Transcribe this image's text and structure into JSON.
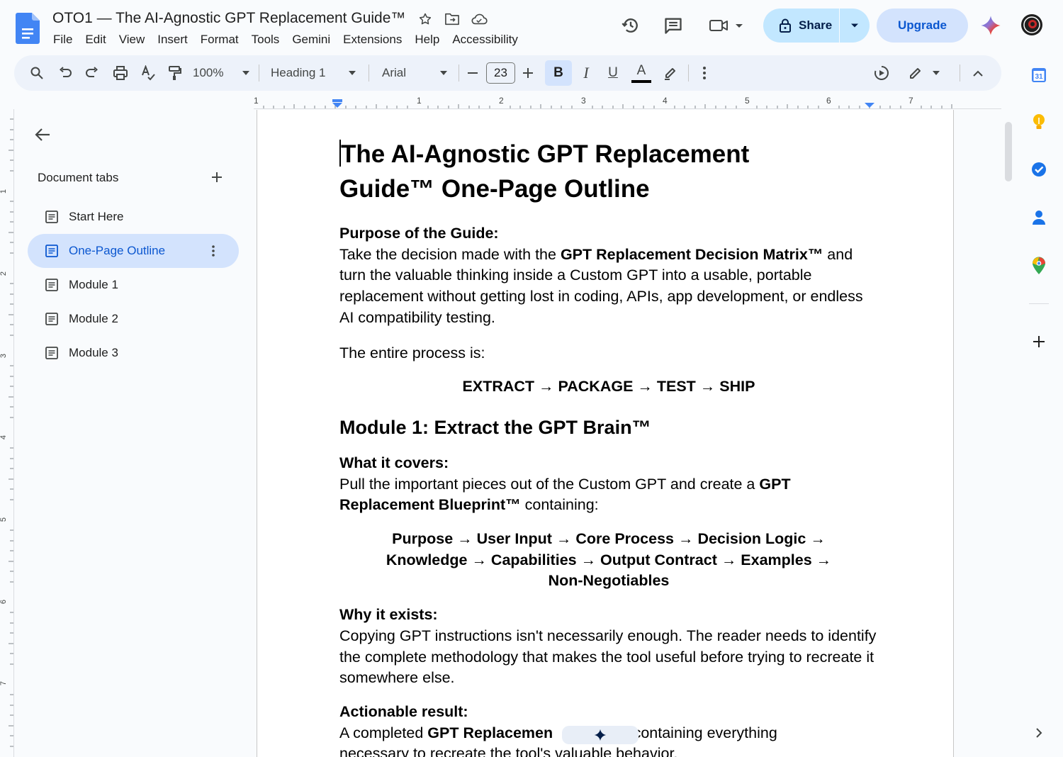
{
  "window": {
    "title": "OTO1 — The AI-Agnostic GPT Replacement Guide™"
  },
  "menu": [
    "File",
    "Edit",
    "View",
    "Insert",
    "Format",
    "Tools",
    "Gemini",
    "Extensions",
    "Help",
    "Accessibility"
  ],
  "header": {
    "share_label": "Share",
    "upgrade_label": "Upgrade"
  },
  "toolbar": {
    "zoom": "100%",
    "style": "Heading 1",
    "font": "Arial",
    "font_size": "23",
    "bold_label": "B",
    "italic_label": "I",
    "underline_label": "U",
    "text_color_label": "A"
  },
  "ruler": {
    "marks": [
      "1",
      "1",
      "2",
      "3",
      "4",
      "5",
      "6",
      "7"
    ],
    "vertical_marks": [
      "1",
      "2",
      "3",
      "4",
      "5",
      "6",
      "7"
    ]
  },
  "sidebar": {
    "heading": "Document tabs",
    "tabs": [
      {
        "label": "Start Here",
        "active": false
      },
      {
        "label": "One-Page Outline",
        "active": true
      },
      {
        "label": "Module 1",
        "active": false
      },
      {
        "label": "Module 2",
        "active": false
      },
      {
        "label": "Module 3",
        "active": false
      }
    ]
  },
  "document": {
    "title_line1": "The AI-Agnostic GPT Replacement",
    "title_line2": "Guide™ One-Page Outline",
    "purpose_heading": "Purpose of the Guide:",
    "purpose_p1": "Take the decision made with the ",
    "purpose_b1": "GPT Replacement Decision Matrix™",
    "purpose_p2": " and turn the valuable thinking inside a Custom GPT into a usable, portable replacement without getting lost in coding, APIs, app development, or endless AI compatibility testing.",
    "process_intro": "The entire process is:",
    "process_flow": "EXTRACT → PACKAGE → TEST → SHIP",
    "module1_heading": "Module 1: Extract the GPT Brain™",
    "covers_heading": "What it covers:",
    "covers_p1": "Pull the important pieces out of the Custom GPT and create a ",
    "covers_b1": "GPT Replacement Blueprint™",
    "covers_p2": " containing:",
    "blueprint_line1": "Purpose → User Input → Core Process → Decision Logic →",
    "blueprint_line2": "Knowledge → Capabilities → Output Contract → Examples →",
    "blueprint_line3": "Non-Negotiables",
    "why_heading": "Why it exists:",
    "why_p": "Copying GPT instructions isn't necessarily enough. The reader needs to identify the complete methodology that makes the tool useful before trying to recreate it somewhere else.",
    "result_heading": "Actionable result:",
    "result_p1": "A completed ",
    "result_b1": "GPT Replacemen",
    "result_p2": "t™ containing everything",
    "result_p3": "necessary to recreate the tool's valuable behavior."
  },
  "colors": {
    "accent": "#0b57d0",
    "share_bg": "#c2e7ff",
    "active_tab_bg": "#d3e3fd",
    "toolbar_bg": "#edf2fa",
    "doc_blue": "#4285f4"
  },
  "icons": {
    "title": [
      "star-icon",
      "move-folder-icon",
      "cloud-saved-icon"
    ],
    "header": [
      "history-icon",
      "comment-icon",
      "meet-icon",
      "lock-icon",
      "gemini-icon"
    ],
    "side_panel": [
      "calendar-icon",
      "keep-icon",
      "tasks-icon",
      "contacts-icon",
      "maps-icon",
      "add-icon",
      "expand-icon"
    ]
  }
}
